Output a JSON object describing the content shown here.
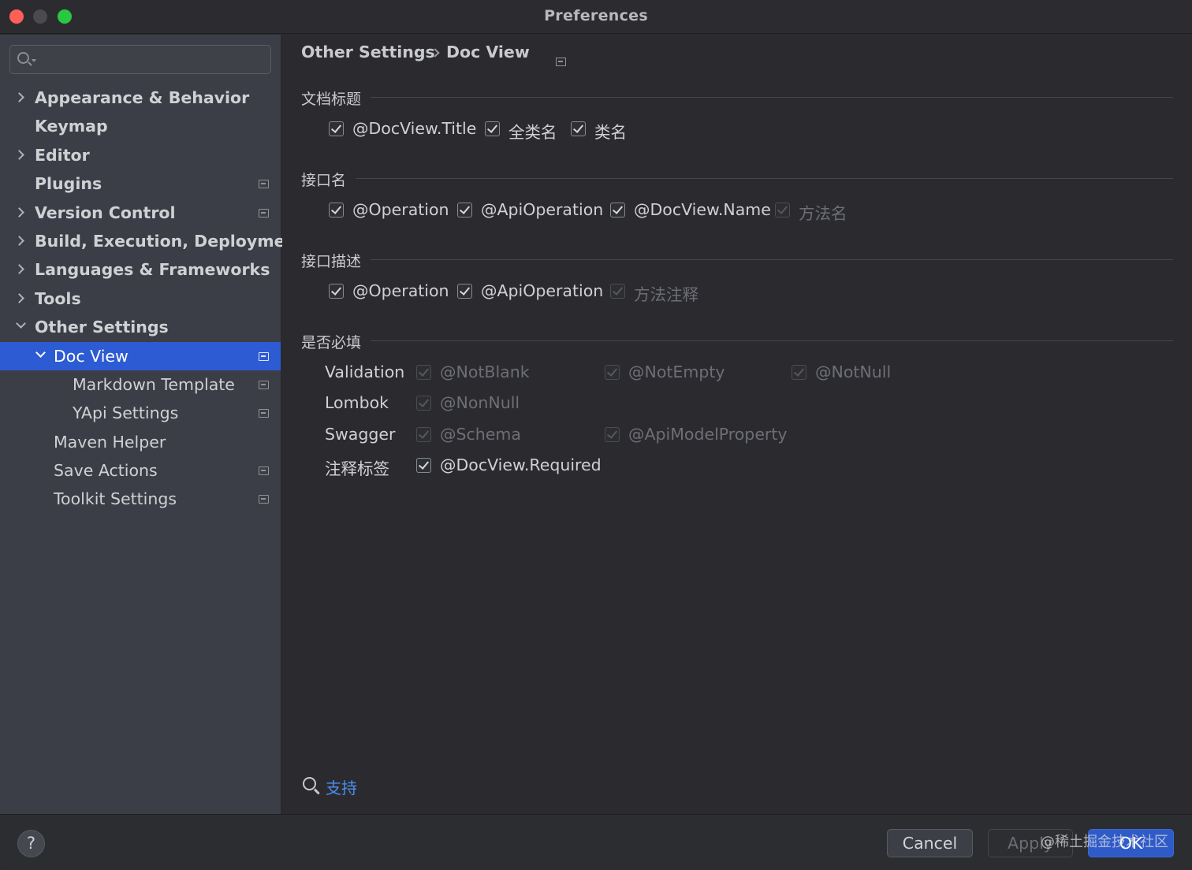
{
  "window": {
    "title": "Preferences"
  },
  "search": {
    "placeholder": ""
  },
  "sidebar": {
    "items": [
      {
        "label": "Appearance & Behavior"
      },
      {
        "label": "Keymap"
      },
      {
        "label": "Editor"
      },
      {
        "label": "Plugins"
      },
      {
        "label": "Version Control"
      },
      {
        "label": "Build, Execution, Deployment"
      },
      {
        "label": "Languages & Frameworks"
      },
      {
        "label": "Tools"
      },
      {
        "label": "Other Settings"
      },
      {
        "label": "Doc View"
      },
      {
        "label": "Markdown Template"
      },
      {
        "label": "YApi Settings"
      },
      {
        "label": "Maven Helper"
      },
      {
        "label": "Save Actions"
      },
      {
        "label": "Toolkit Settings"
      }
    ]
  },
  "breadcrumb": {
    "parent": "Other Settings",
    "current": "Doc View"
  },
  "sections": {
    "doc_title": {
      "title": "文档标题",
      "options": [
        {
          "label": "@DocView.Title",
          "checked": true,
          "enabled": true
        },
        {
          "label": "全类名",
          "checked": true,
          "enabled": true
        },
        {
          "label": "类名",
          "checked": true,
          "enabled": true
        }
      ]
    },
    "api_name": {
      "title": "接口名",
      "options": [
        {
          "label": "@Operation",
          "checked": true,
          "enabled": true
        },
        {
          "label": "@ApiOperation",
          "checked": true,
          "enabled": true
        },
        {
          "label": "@DocView.Name",
          "checked": true,
          "enabled": true
        },
        {
          "label": "方法名",
          "checked": true,
          "enabled": false
        }
      ]
    },
    "api_desc": {
      "title": "接口描述",
      "options": [
        {
          "label": "@Operation",
          "checked": true,
          "enabled": true
        },
        {
          "label": "@ApiOperation",
          "checked": true,
          "enabled": true
        },
        {
          "label": "方法注释",
          "checked": true,
          "enabled": false
        }
      ]
    },
    "required": {
      "title": "是否必填",
      "rows": [
        {
          "label": "Validation",
          "options": [
            {
              "label": "@NotBlank",
              "checked": true,
              "enabled": false
            },
            {
              "label": "@NotEmpty",
              "checked": true,
              "enabled": false
            },
            {
              "label": "@NotNull",
              "checked": true,
              "enabled": false
            }
          ]
        },
        {
          "label": "Lombok",
          "options": [
            {
              "label": "@NonNull",
              "checked": true,
              "enabled": false
            }
          ]
        },
        {
          "label": "Swagger",
          "options": [
            {
              "label": "@Schema",
              "checked": true,
              "enabled": false
            },
            {
              "label": "@ApiModelProperty",
              "checked": true,
              "enabled": false
            }
          ]
        },
        {
          "label": "注释标签",
          "options": [
            {
              "label": "@DocView.Required",
              "checked": true,
              "enabled": true
            }
          ]
        }
      ]
    }
  },
  "support": {
    "label": "支持"
  },
  "footer": {
    "help": "?",
    "cancel": "Cancel",
    "apply": "Apply",
    "ok": "OK",
    "watermark": "@稀土掘金技术社区"
  },
  "colors": {
    "accent": "#2d5bd3",
    "link": "#4c8ef0"
  }
}
